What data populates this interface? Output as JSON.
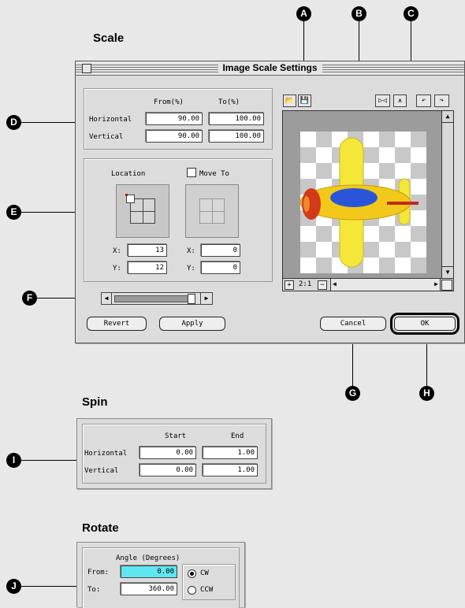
{
  "headings": {
    "scale": "Scale",
    "spin": "Spin",
    "rotate": "Rotate"
  },
  "callouts": {
    "a": "A",
    "b": "B",
    "c": "C",
    "d": "D",
    "e": "E",
    "f": "F",
    "g": "G",
    "h": "H",
    "i": "I",
    "j": "J"
  },
  "scale_window": {
    "title": "Image Scale Settings",
    "scale_table": {
      "from_header": "From(%)",
      "to_header": "To(%)",
      "rows": [
        {
          "label": "Horizontal",
          "from": "90.00",
          "to": "100.00"
        },
        {
          "label": "Vertical",
          "from": "90.00",
          "to": "100.00"
        }
      ]
    },
    "location": {
      "label": "Location",
      "move_to_label": "Move To",
      "move_to_checked": false,
      "x_label": "X:",
      "y_label": "Y:",
      "x": "13",
      "y": "12",
      "move_x": "0",
      "move_y": "0"
    },
    "buttons": {
      "revert": "Revert",
      "apply": "Apply",
      "cancel": "Cancel",
      "ok": "OK"
    },
    "preview": {
      "zoom": "2:1",
      "zoom_in_icon": "+",
      "zoom_out_icon": "−"
    },
    "toolbar_icons": [
      "open-folder-icon",
      "save-disk-icon",
      "flip-horizontal-icon",
      "flip-vertical-icon",
      "rotate-left-icon",
      "rotate-right-icon"
    ]
  },
  "spin": {
    "start_header": "Start",
    "end_header": "End",
    "rows": [
      {
        "label": "Horizontal",
        "start": "0.00",
        "end": "1.00"
      },
      {
        "label": "Vertical",
        "start": "0.00",
        "end": "1.00"
      }
    ]
  },
  "rotate": {
    "group_label": "Angle (Degrees)",
    "from_label": "From:",
    "to_label": "To:",
    "from": "0.00",
    "to": "360.00",
    "cw_label": "CW",
    "ccw_label": "CCW",
    "selected": "CW",
    "highlight_color": "#5fe6f0"
  }
}
